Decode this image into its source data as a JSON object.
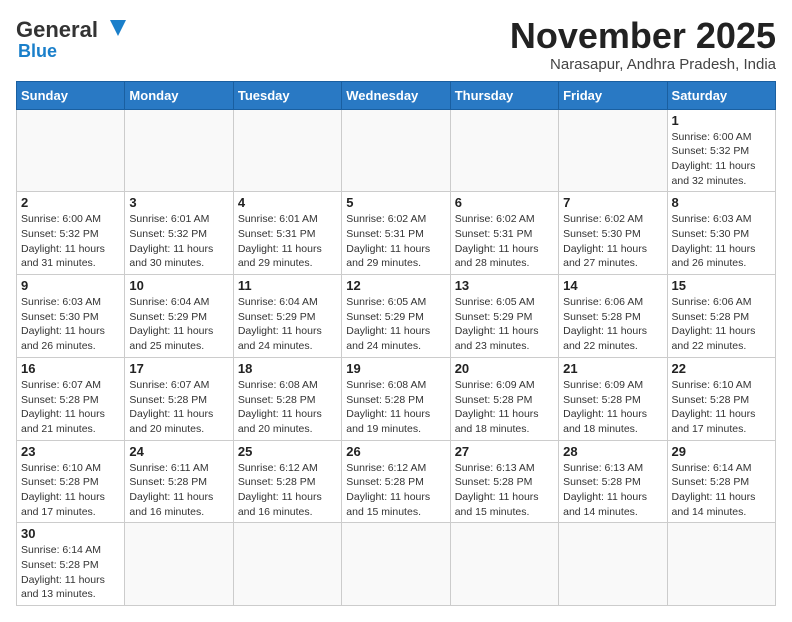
{
  "header": {
    "logo_line1": "General",
    "logo_line2": "Blue",
    "month_title": "November 2025",
    "location": "Narasapur, Andhra Pradesh, India"
  },
  "days_of_week": [
    "Sunday",
    "Monday",
    "Tuesday",
    "Wednesday",
    "Thursday",
    "Friday",
    "Saturday"
  ],
  "weeks": [
    [
      {
        "day": "",
        "info": ""
      },
      {
        "day": "",
        "info": ""
      },
      {
        "day": "",
        "info": ""
      },
      {
        "day": "",
        "info": ""
      },
      {
        "day": "",
        "info": ""
      },
      {
        "day": "",
        "info": ""
      },
      {
        "day": "1",
        "info": "Sunrise: 6:00 AM\nSunset: 5:32 PM\nDaylight: 11 hours\nand 32 minutes."
      }
    ],
    [
      {
        "day": "2",
        "info": "Sunrise: 6:00 AM\nSunset: 5:32 PM\nDaylight: 11 hours\nand 31 minutes."
      },
      {
        "day": "3",
        "info": "Sunrise: 6:01 AM\nSunset: 5:32 PM\nDaylight: 11 hours\nand 30 minutes."
      },
      {
        "day": "4",
        "info": "Sunrise: 6:01 AM\nSunset: 5:31 PM\nDaylight: 11 hours\nand 29 minutes."
      },
      {
        "day": "5",
        "info": "Sunrise: 6:02 AM\nSunset: 5:31 PM\nDaylight: 11 hours\nand 29 minutes."
      },
      {
        "day": "6",
        "info": "Sunrise: 6:02 AM\nSunset: 5:31 PM\nDaylight: 11 hours\nand 28 minutes."
      },
      {
        "day": "7",
        "info": "Sunrise: 6:02 AM\nSunset: 5:30 PM\nDaylight: 11 hours\nand 27 minutes."
      },
      {
        "day": "8",
        "info": "Sunrise: 6:03 AM\nSunset: 5:30 PM\nDaylight: 11 hours\nand 26 minutes."
      }
    ],
    [
      {
        "day": "9",
        "info": "Sunrise: 6:03 AM\nSunset: 5:30 PM\nDaylight: 11 hours\nand 26 minutes."
      },
      {
        "day": "10",
        "info": "Sunrise: 6:04 AM\nSunset: 5:29 PM\nDaylight: 11 hours\nand 25 minutes."
      },
      {
        "day": "11",
        "info": "Sunrise: 6:04 AM\nSunset: 5:29 PM\nDaylight: 11 hours\nand 24 minutes."
      },
      {
        "day": "12",
        "info": "Sunrise: 6:05 AM\nSunset: 5:29 PM\nDaylight: 11 hours\nand 24 minutes."
      },
      {
        "day": "13",
        "info": "Sunrise: 6:05 AM\nSunset: 5:29 PM\nDaylight: 11 hours\nand 23 minutes."
      },
      {
        "day": "14",
        "info": "Sunrise: 6:06 AM\nSunset: 5:28 PM\nDaylight: 11 hours\nand 22 minutes."
      },
      {
        "day": "15",
        "info": "Sunrise: 6:06 AM\nSunset: 5:28 PM\nDaylight: 11 hours\nand 22 minutes."
      }
    ],
    [
      {
        "day": "16",
        "info": "Sunrise: 6:07 AM\nSunset: 5:28 PM\nDaylight: 11 hours\nand 21 minutes."
      },
      {
        "day": "17",
        "info": "Sunrise: 6:07 AM\nSunset: 5:28 PM\nDaylight: 11 hours\nand 20 minutes."
      },
      {
        "day": "18",
        "info": "Sunrise: 6:08 AM\nSunset: 5:28 PM\nDaylight: 11 hours\nand 20 minutes."
      },
      {
        "day": "19",
        "info": "Sunrise: 6:08 AM\nSunset: 5:28 PM\nDaylight: 11 hours\nand 19 minutes."
      },
      {
        "day": "20",
        "info": "Sunrise: 6:09 AM\nSunset: 5:28 PM\nDaylight: 11 hours\nand 18 minutes."
      },
      {
        "day": "21",
        "info": "Sunrise: 6:09 AM\nSunset: 5:28 PM\nDaylight: 11 hours\nand 18 minutes."
      },
      {
        "day": "22",
        "info": "Sunrise: 6:10 AM\nSunset: 5:28 PM\nDaylight: 11 hours\nand 17 minutes."
      }
    ],
    [
      {
        "day": "23",
        "info": "Sunrise: 6:10 AM\nSunset: 5:28 PM\nDaylight: 11 hours\nand 17 minutes."
      },
      {
        "day": "24",
        "info": "Sunrise: 6:11 AM\nSunset: 5:28 PM\nDaylight: 11 hours\nand 16 minutes."
      },
      {
        "day": "25",
        "info": "Sunrise: 6:12 AM\nSunset: 5:28 PM\nDaylight: 11 hours\nand 16 minutes."
      },
      {
        "day": "26",
        "info": "Sunrise: 6:12 AM\nSunset: 5:28 PM\nDaylight: 11 hours\nand 15 minutes."
      },
      {
        "day": "27",
        "info": "Sunrise: 6:13 AM\nSunset: 5:28 PM\nDaylight: 11 hours\nand 15 minutes."
      },
      {
        "day": "28",
        "info": "Sunrise: 6:13 AM\nSunset: 5:28 PM\nDaylight: 11 hours\nand 14 minutes."
      },
      {
        "day": "29",
        "info": "Sunrise: 6:14 AM\nSunset: 5:28 PM\nDaylight: 11 hours\nand 14 minutes."
      }
    ],
    [
      {
        "day": "30",
        "info": "Sunrise: 6:14 AM\nSunset: 5:28 PM\nDaylight: 11 hours\nand 13 minutes."
      },
      {
        "day": "",
        "info": ""
      },
      {
        "day": "",
        "info": ""
      },
      {
        "day": "",
        "info": ""
      },
      {
        "day": "",
        "info": ""
      },
      {
        "day": "",
        "info": ""
      },
      {
        "day": "",
        "info": ""
      }
    ]
  ]
}
